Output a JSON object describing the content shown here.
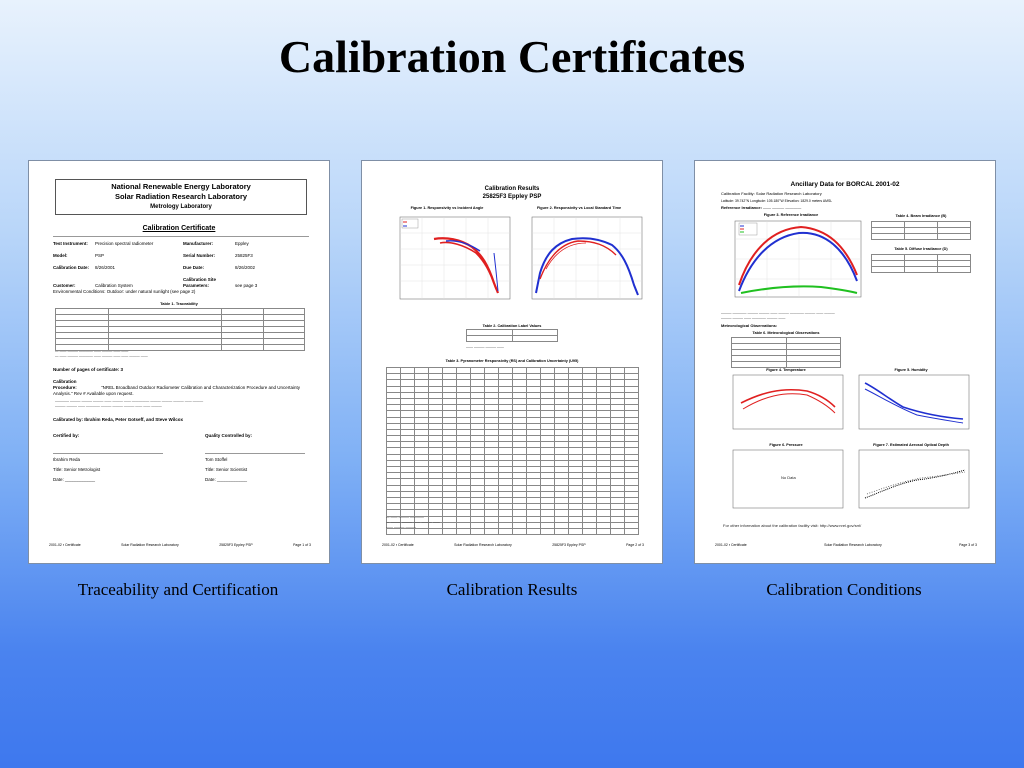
{
  "slide": {
    "title": "Calibration Certificates",
    "captions": [
      "Traceability and Certification",
      "Calibration Results",
      "Calibration Conditions"
    ]
  },
  "page1": {
    "org": "National Renewable Energy Laboratory",
    "center": "Solar Radiation Research Laboratory",
    "lab": "Metrology Laboratory",
    "cert_title": "Calibration Certificate",
    "fields": [
      {
        "label": "Test Instrument:",
        "value": "Precision spectral radiometer",
        "label2": "Manufacturer:",
        "value2": "Eppley"
      },
      {
        "label": "Model:",
        "value": "PSP",
        "label2": "Serial Number:",
        "value2": "25825F3"
      },
      {
        "label": "Calibration Date:",
        "value": "8/26/2001",
        "label2": "Due Date:",
        "value2": "8/26/2002"
      },
      {
        "label": "Customer:",
        "value": "Calibration System",
        "label2": "Calibration Site Parameters:",
        "value2": "see page 3"
      }
    ],
    "env": "Environmental Conditions:  Outdoor: under natural sunlight (see page 2)",
    "table_caption": "Table 1.  Traceability",
    "pages_line": "Number of pages of certificate:   3",
    "procedure_label": "Calibration Procedure:",
    "procedure": "\"NREL Broadband Outdoor Radiometer Calibration and Characterization Procedure and Uncertainty Analysis.\" Rev # Available upon request.",
    "calibrated_by": "Calibrated by:   Ibrahim Reda, Peter Gotseff, and Steve Wilcox",
    "certified_by": "Certified by:",
    "qc_by": "Quality Controlled by:",
    "signer1": "Ibrahim Reda",
    "signer1_title": "Title:  Senior Metrologist",
    "signer2": "Tom Stoffel",
    "signer2_title": "Title:  Senior Scientist",
    "date_label": "Date: ____________",
    "footer": [
      "2001-02 r Certificate",
      "Solar Radiation Research Laboratory",
      "25825F3 Eppley PSP",
      "Page 1 of 3"
    ]
  },
  "page2": {
    "title1": "Calibration Results",
    "title2": "25825F3 Eppley PSP",
    "fig1": "Figure 1.  Responsivity vs Incident Angle",
    "fig2": "Figure 2.  Responsivity vs Local Standard Time",
    "tbl2": "Table 2.  Calibration Label Values",
    "tbl3": "Table 3.  Pyranometer Responsivity (RS) and Calibration Uncertainty (U95)",
    "footer": [
      "2001-02 r Certificate",
      "Solar Radiation Research Laboratory",
      "25825F3 Eppley PSP",
      "Page 2 of 3"
    ]
  },
  "page3": {
    "title": "Ancillary Data for BORCAL 2001-02",
    "facility": "Calibration Facility:  Solar Radiation Research Laboratory",
    "location": "Latitude: 39.742°N     Longitude: 105.180°W     Elevation: 1829.0 meters AMSL",
    "fig3": "Figure 3.  Reference Irradiance",
    "tbl4": "Table 4.  Beam Irradiance (B)",
    "tbl5": "Table 5.  Diffuse Irradiance (D)",
    "met": "Meteorological Observations:",
    "tbl6": "Table 6.  Meteorological Observations",
    "fig4": "Figure 4.  Temperature",
    "fig5": "Figure 5.  Humidity",
    "fig6": "Figure 6.  Pressure",
    "fig7": "Figure 7.  Estimated Aerosol Optical Depth",
    "nodata": "No Data",
    "other": "For other information about the calibration facility visit:  http://www.nrel.gov/srrl/",
    "footer": [
      "2001-02 r Certificate",
      "Solar Radiation Research Laboratory",
      "Page 3 of 3"
    ]
  },
  "colors": {
    "red_series": "#e02020",
    "blue_series": "#2030d0",
    "green_series": "#20c020"
  }
}
